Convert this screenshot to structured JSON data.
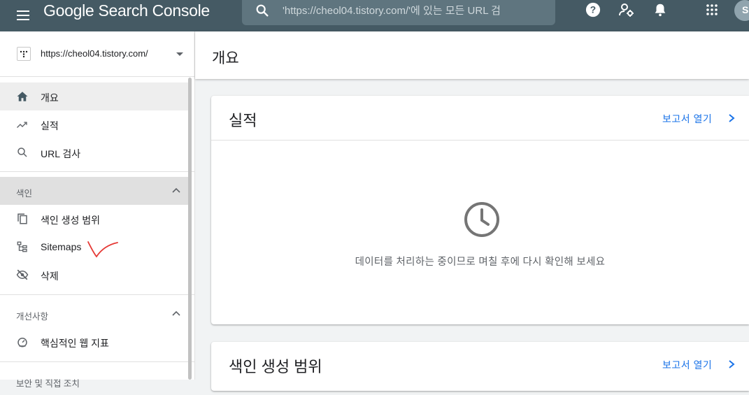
{
  "app": {
    "title": "Google Search Console",
    "avatar_initial": "S"
  },
  "search": {
    "placeholder": "'https://cheol04.tistory.com/'에 있는 모든 URL 검"
  },
  "topbar_icons": [
    "menu-icon",
    "search-icon",
    "help-icon",
    "manage-users-icon",
    "notifications-bell-icon",
    "apps-grid-icon",
    "account-avatar"
  ],
  "property": {
    "url": "https://cheol04.tistory.com/"
  },
  "sidebar": {
    "items": [
      {
        "label": "개요",
        "icon": "home-icon",
        "active": true
      },
      {
        "label": "실적",
        "icon": "trending-up-icon"
      },
      {
        "label": "URL 검사",
        "icon": "search-icon"
      }
    ],
    "index_section": {
      "label": "색인",
      "items": [
        {
          "label": "색인 생성 범위",
          "icon": "copy-pages-icon"
        },
        {
          "label": "Sitemaps",
          "icon": "sitemap-icon"
        },
        {
          "label": "삭제",
          "icon": "hidden-eye-icon"
        }
      ]
    },
    "enhancements_section": {
      "label": "개선사항",
      "items": [
        {
          "label": "핵심적인 웹 지표",
          "icon": "speed-gauge-icon"
        }
      ]
    },
    "security_section": {
      "label": "보안 및 직접 조치"
    }
  },
  "main": {
    "title": "개요",
    "cards": [
      {
        "title": "실적",
        "link": "보고서 열기",
        "message": "데이터를 처리하는 중이므로 며칠 후에 다시 확인해 보세요"
      },
      {
        "title": "색인 생성 범위",
        "link": "보고서 열기"
      }
    ]
  },
  "colors": {
    "topbar": "#455a64",
    "link": "#1a73e8",
    "annotation_mark": "#e53935"
  }
}
